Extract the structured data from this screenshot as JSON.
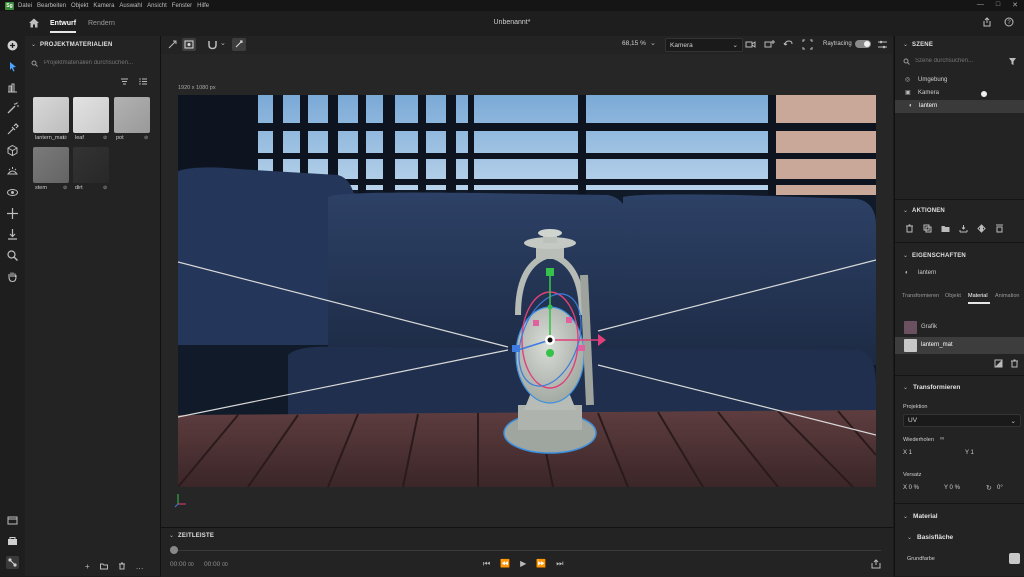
{
  "app": {
    "logo": "Sg",
    "menu": [
      "Datei",
      "Bearbeiten",
      "Objekt",
      "Kamera",
      "Auswahl",
      "Ansicht",
      "Fenster",
      "Hilfe"
    ]
  },
  "title_bar": {
    "tabs": [
      "Entwurf",
      "Rendern"
    ],
    "document_title": "Unbenannt*"
  },
  "materials_panel": {
    "header": "PROJEKTMATERIALIEN",
    "search_placeholder": "Projektmaterialien durchsuchen...",
    "materials": [
      {
        "name": "lantern_mat",
        "color": "#c8c8c8"
      },
      {
        "name": "leaf",
        "color": "#d4d4d4"
      },
      {
        "name": "pot",
        "color": "#a7a7a7"
      },
      {
        "name": "stem",
        "color": "#6f6f6f"
      },
      {
        "name": "dirt",
        "color": "#2e2e2e"
      }
    ]
  },
  "viewport": {
    "zoom": "68,15 %",
    "camera": "Kamera",
    "raytracing_label": "Raytracing",
    "resolution": "1920 x 1080 px"
  },
  "timeline": {
    "header": "ZEITLEISTE",
    "time_current": "00:00",
    "time_current_frames": "00",
    "time_end": "00:00",
    "time_end_frames": "00"
  },
  "scene_panel": {
    "header": "SZENE",
    "search_placeholder": "Szene durchsuchen...",
    "items": [
      "Umgebung",
      "Kamera",
      "lantern"
    ]
  },
  "actions_panel": {
    "header": "AKTIONEN"
  },
  "properties_panel": {
    "header": "EIGENSCHAFTEN",
    "object_name": "lantern",
    "tabs": [
      "Transformieren",
      "Objekt",
      "Material",
      "Animation"
    ],
    "active_tab": "Material",
    "materials": [
      "Grafik",
      "lantern_mat"
    ],
    "transform": {
      "header": "Transformieren",
      "projection_label": "Projektion",
      "projection_value": "UV",
      "repeat_label": "Wiederholen",
      "x_repeat": "X 1",
      "y_repeat": "Y 1",
      "offset_label": "Versatz",
      "x_offset": "X 0 %",
      "y_offset": "Y 0 %",
      "rotation": "0°"
    },
    "material": {
      "header": "Material",
      "basis": "Basisfläche",
      "base_color_label": "Grundfarbe"
    }
  }
}
